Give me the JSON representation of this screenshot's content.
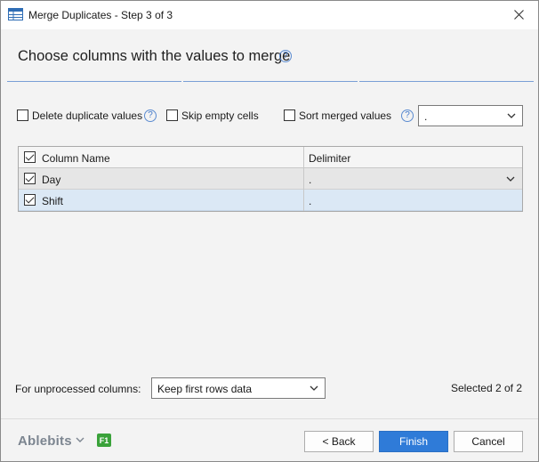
{
  "window": {
    "title": "Merge Duplicates - Step 3 of 3"
  },
  "step": {
    "heading": "Choose columns with the values to merge",
    "help_icon": "?"
  },
  "options": {
    "delete_duplicates": {
      "label": "Delete duplicate values",
      "checked": false
    },
    "skip_empty": {
      "label": "Skip empty cells",
      "checked": false
    },
    "sort_merged": {
      "label": "Sort merged values",
      "checked": false
    },
    "delimiter_value": "."
  },
  "grid": {
    "headers": {
      "column_name": "Column Name",
      "delimiter": "Delimiter"
    },
    "rows": [
      {
        "name": "Day",
        "delimiter": ".",
        "checked": true
      },
      {
        "name": "Shift",
        "delimiter": ".",
        "checked": true
      }
    ]
  },
  "footer": {
    "unprocessed_label": "For unprocessed columns:",
    "unprocessed_value": "Keep first rows data",
    "selected_count": "Selected 2 of 2",
    "brand": "Ablebits",
    "f1_badge": "F1"
  },
  "buttons": {
    "back": "< Back",
    "finish": "Finish",
    "cancel": "Cancel"
  },
  "colors": {
    "primary_button": "#2f7bd8",
    "help_icon": "#3f76c9",
    "f1_badge": "#3aa23a",
    "selected_row": "#dbe8f5"
  }
}
